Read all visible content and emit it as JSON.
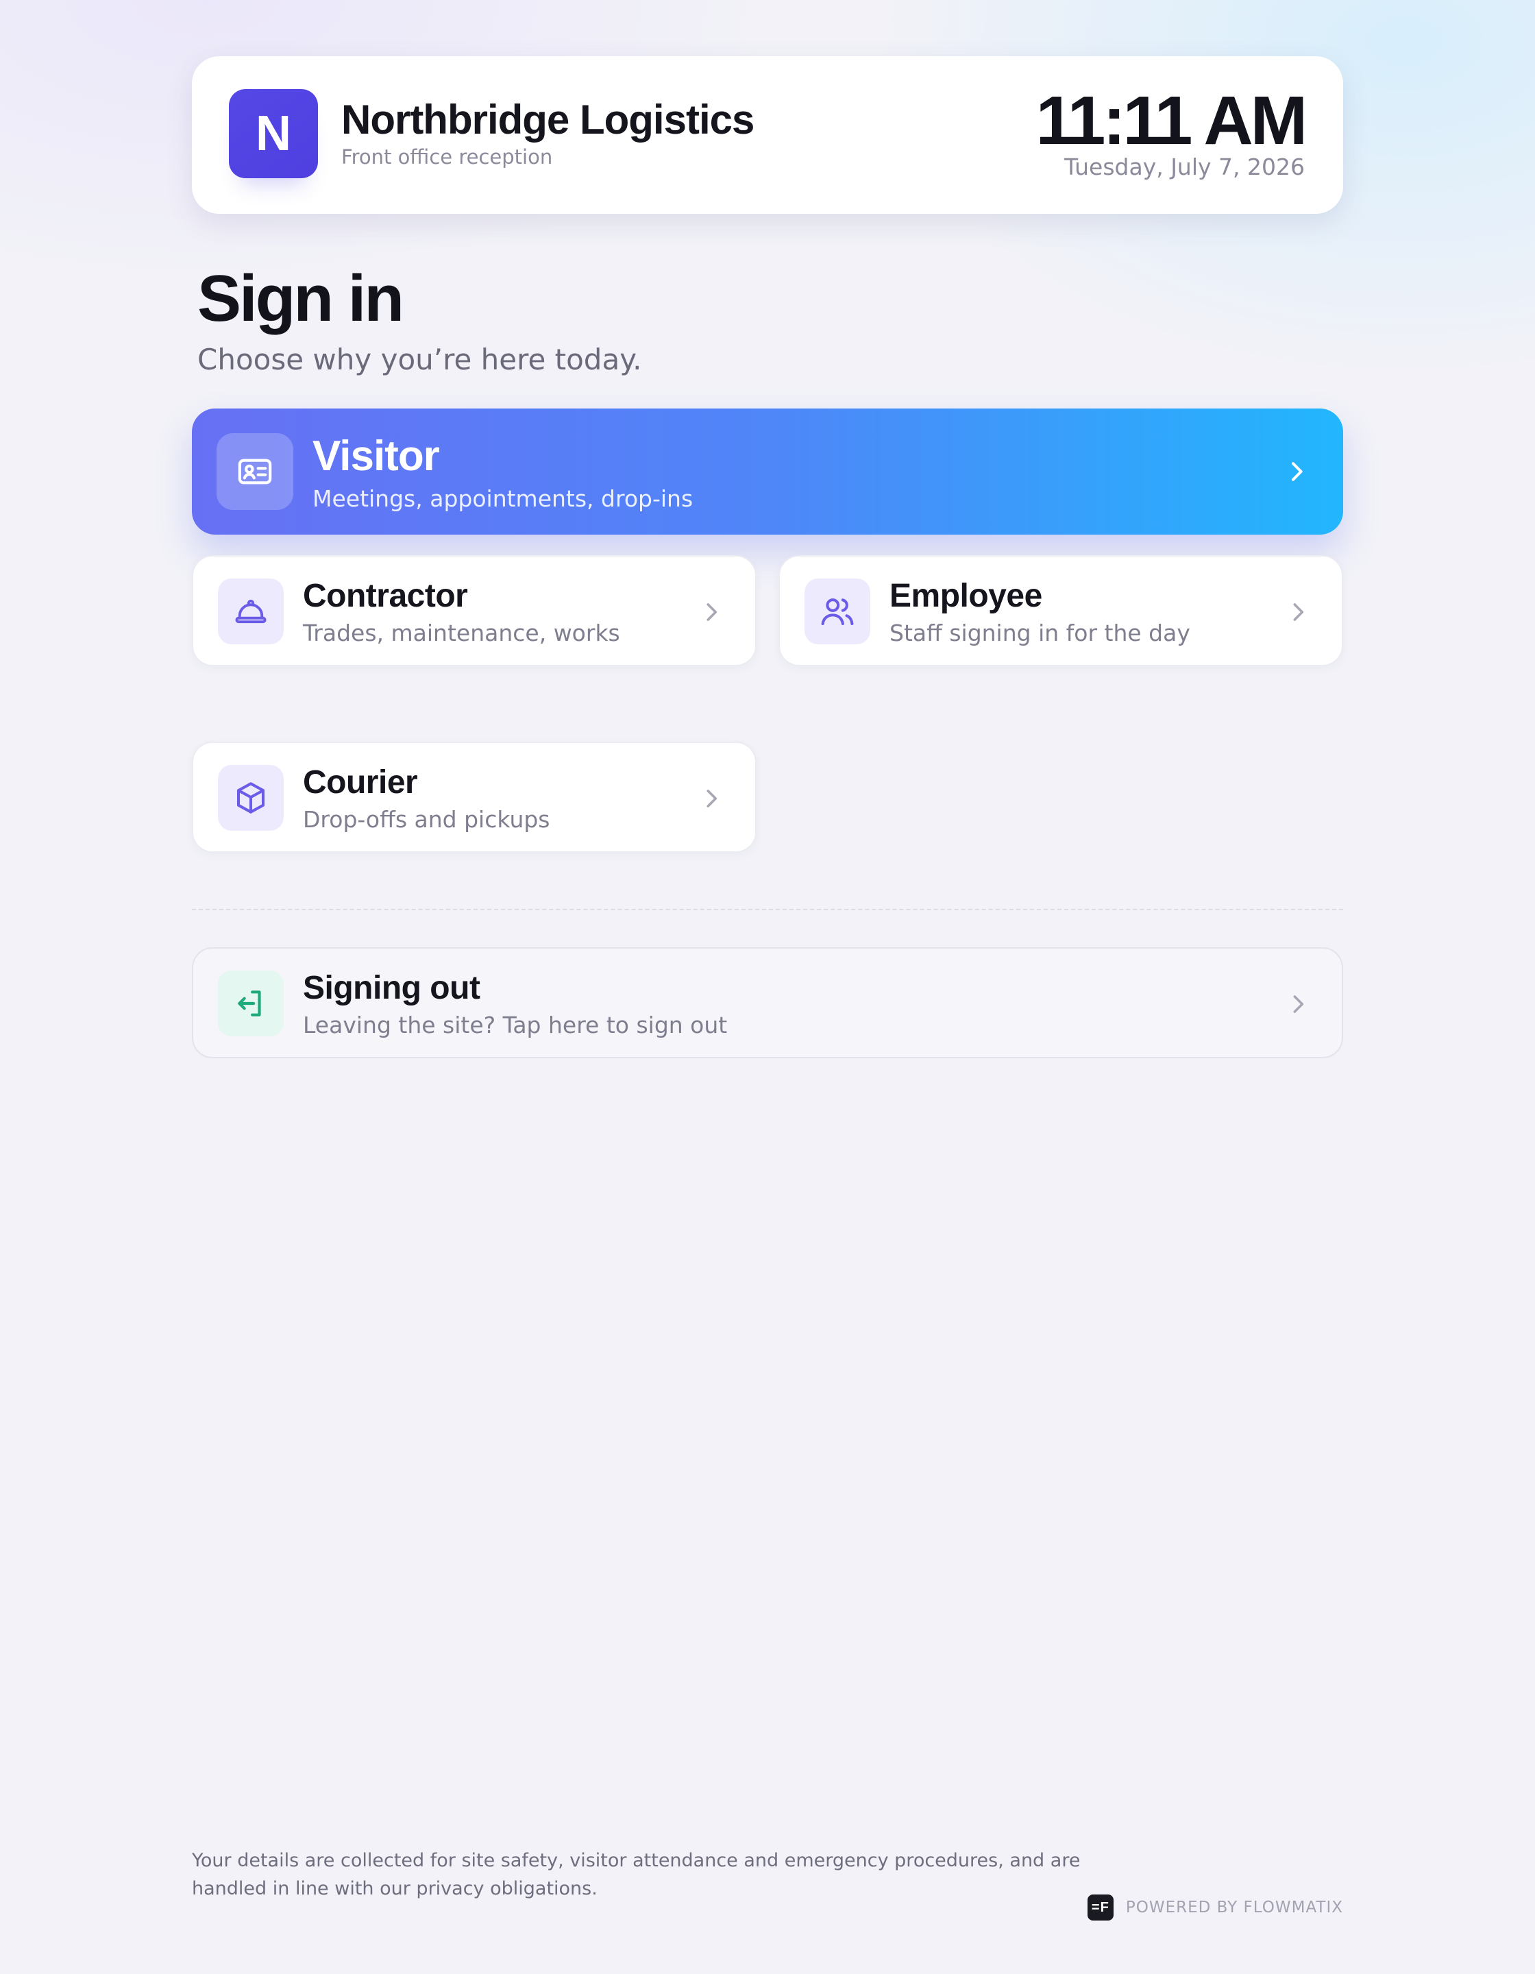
{
  "header": {
    "logo_letter": "N",
    "org_name": "Northbridge Logistics",
    "org_subtitle": "Front office reception",
    "time": "11:11 AM",
    "date": "Tuesday, July 7, 2026"
  },
  "page": {
    "title": "Sign in",
    "subtitle": "Choose why you’re here today."
  },
  "options": {
    "visitor": {
      "title": "Visitor",
      "subtitle": "Meetings, appointments, drop-ins",
      "icon": "id-card-icon"
    },
    "contractor": {
      "title": "Contractor",
      "subtitle": "Trades, maintenance, works",
      "icon": "hard-hat-icon"
    },
    "employee": {
      "title": "Employee",
      "subtitle": "Staff signing in for the day",
      "icon": "users-icon"
    },
    "courier": {
      "title": "Courier",
      "subtitle": "Drop-offs and pickups",
      "icon": "package-icon"
    }
  },
  "signout": {
    "title": "Signing out",
    "subtitle": "Leaving the site? Tap here to sign out",
    "icon": "log-out-icon"
  },
  "footer": {
    "note": "Your details are collected for site safety, visitor attendance and emergency procedures, and are handled in line with our privacy obligations.",
    "powered_by": "POWERED BY FLOWMATIX",
    "powered_logo": "=F"
  },
  "colors": {
    "brand": "#5046E5",
    "hero_start": "#6770F4",
    "hero_end": "#22B6FD",
    "icon_purple": "#6B5CE7",
    "icon_green": "#1FA97A"
  }
}
